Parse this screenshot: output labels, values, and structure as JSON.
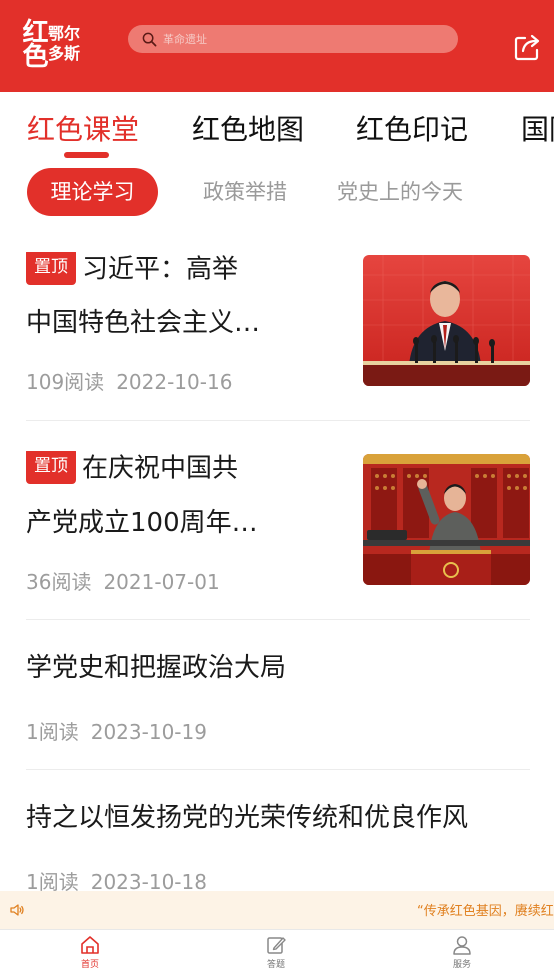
{
  "header": {
    "logo_main": "红色",
    "logo_sub": "鄂尔多斯",
    "search_placeholder": "革命遗址"
  },
  "main_tabs": [
    "红色课堂",
    "红色地图",
    "红色印记",
    "国防"
  ],
  "sub_tabs": [
    "理论学习",
    "政策举措",
    "党史上的今天"
  ],
  "articles": [
    {
      "badge": "置顶",
      "title_line1": "习近平：高举",
      "title_line2": "中国特色社会主义…",
      "reads": "109阅读",
      "date": "2022-10-16"
    },
    {
      "badge": "置顶",
      "title_line1": "在庆祝中国共",
      "title_line2": "产党成立100周年…",
      "reads": "36阅读",
      "date": "2021-07-01"
    },
    {
      "title": "学党史和把握政治大局",
      "reads": "1阅读",
      "date": "2023-10-19"
    },
    {
      "title": "持之以恒发扬党的光荣传统和优良作风",
      "reads": "1阅读",
      "date": "2023-10-18"
    }
  ],
  "ticker": {
    "text": "“传承红色基因，赓续红"
  },
  "bottom_nav": [
    {
      "label": "首页",
      "icon": "home-icon"
    },
    {
      "label": "答题",
      "icon": "edit-icon"
    },
    {
      "label": "服务",
      "icon": "user-icon"
    }
  ],
  "colors": {
    "primary": "#e2302a",
    "ticker_bg": "#fdf3e6",
    "ticker_text": "#e08020"
  }
}
